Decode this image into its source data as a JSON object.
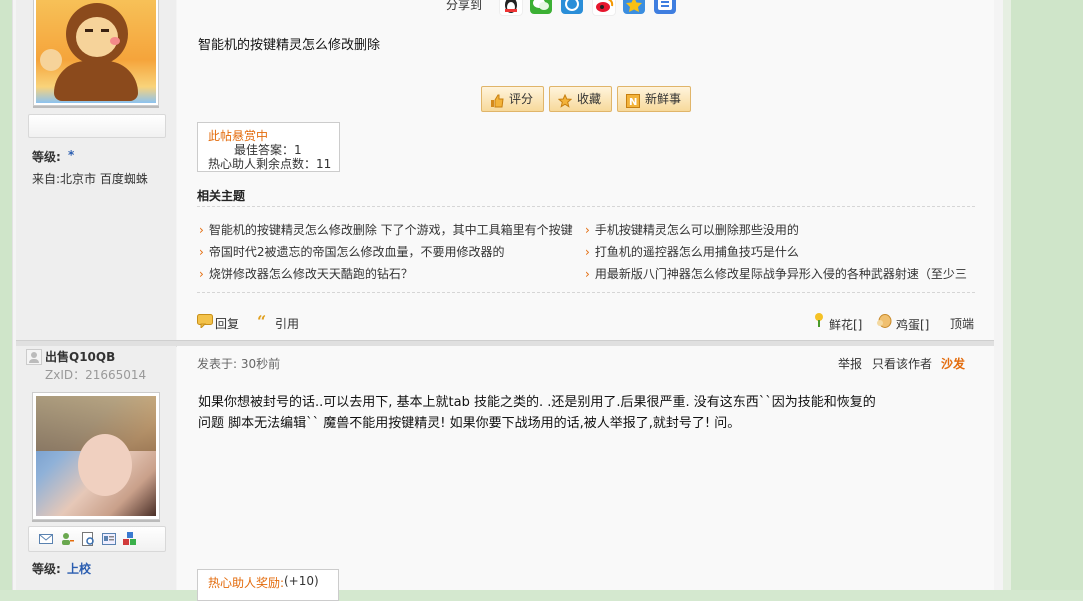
{
  "colors": {
    "accent_orange": "#e36b0c",
    "link_blue": "#2a5db0",
    "page_bg": "#d4e8cf"
  },
  "post1": {
    "share_label": "分享到",
    "share_icons": [
      "qq-icon",
      "wechat-icon",
      "pengyou-icon",
      "weibo-icon",
      "qzone-icon",
      "tieba-icon"
    ],
    "body": "智能机的按键精灵怎么修改删除",
    "actions": [
      {
        "icon": "thumbs-up-icon",
        "label": "评分"
      },
      {
        "icon": "star-icon",
        "label": "收藏"
      },
      {
        "icon": "new-icon",
        "label": "新鲜事"
      }
    ],
    "bounty": {
      "title": "此帖悬赏中",
      "best": "最佳答案：1",
      "points": "热心助人剩余点数：11"
    },
    "related": {
      "title": "相关主题",
      "items": [
        "智能机的按键精灵怎么修改删除 下了个游戏，其中工具箱里有个按键",
        "手机按键精灵怎么可以删除那些没用的",
        "帝国时代2被遗忘的帝国怎么修改血量，不要用修改器的",
        "打鱼机的遥控器怎么用捕鱼技巧是什么",
        "烧饼修改器怎么修改天天酷跑的钻石？",
        "用最新版八门神器怎么修改星际战争异形入侵的各种武器射速（至少三"
      ]
    },
    "footer": {
      "reply": "回复",
      "quote": "引用",
      "flower": "鲜花[]",
      "egg": "鸡蛋[]",
      "top": "顶端"
    },
    "sidebar": {
      "level_label": "等级:",
      "level_value": "*",
      "from": "来自:北京市 百度蜘蛛"
    }
  },
  "post2": {
    "username": "出售Q10QB",
    "zxid": "ZxID：21665014",
    "meta": {
      "time": "发表于: 30秒前",
      "report": "举报",
      "only_author": "只看该作者",
      "sofa": "沙发"
    },
    "body_line1": "如果你想被封号的话..可以去用下, 基本上就tab 技能之类的. .还是别用了.后果很严重. 没有这东西``因为技能和恢复的",
    "body_line2": "问题 脚本无法编辑`` 魔兽不能用按键精灵! 如果你要下战场用的话,被人举报了,就封号了! 问。",
    "sidebar": {
      "level_label": "等级:",
      "level_value": "上校"
    },
    "toolbar_icons": [
      "mail-icon",
      "add-friend-icon",
      "profile-icon",
      "card-icon",
      "blocks-icon"
    ],
    "reward": {
      "label": "热心助人奖励:",
      "value": "(+10)"
    }
  }
}
